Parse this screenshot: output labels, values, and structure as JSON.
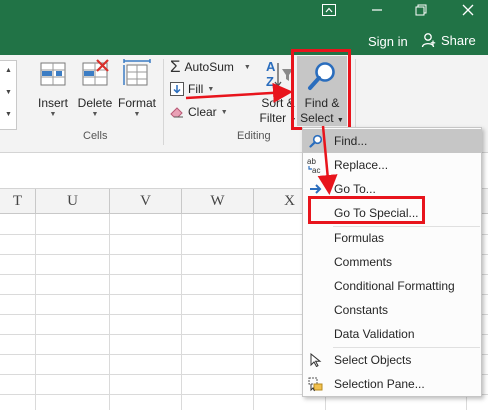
{
  "window": {
    "controls": [
      "restore-ribbon",
      "minimize",
      "restore",
      "close"
    ],
    "signin": "Sign in",
    "share": "Share"
  },
  "ribbon": {
    "cells_group": {
      "label": "Cells",
      "insert": "Insert",
      "delete": "Delete",
      "format": "Format"
    },
    "editing_group": {
      "label": "Editing",
      "autosum": "AutoSum",
      "fill": "Fill",
      "clear": "Clear",
      "sort_filter_line1": "Sort &",
      "sort_filter_line2": "Filter",
      "find_select_line1": "Find &",
      "find_select_line2": "Select"
    }
  },
  "grid": {
    "columns": [
      "T",
      "U",
      "V",
      "W",
      "X"
    ]
  },
  "menu": {
    "items": [
      {
        "label": "Find...",
        "icon": "magnifier-icon"
      },
      {
        "label": "Replace...",
        "icon": "replace-icon"
      },
      {
        "label": "Go To...",
        "icon": "arrow-right-icon"
      },
      {
        "label": "Go To Special...",
        "icon": ""
      },
      {
        "label": "Formulas",
        "icon": ""
      },
      {
        "label": "Comments",
        "icon": ""
      },
      {
        "label": "Conditional Formatting",
        "icon": ""
      },
      {
        "label": "Constants",
        "icon": ""
      },
      {
        "label": "Data Validation",
        "icon": ""
      },
      {
        "label": "Select Objects",
        "icon": "pointer-icon"
      },
      {
        "label": "Selection Pane...",
        "icon": "selection-pane-icon"
      }
    ]
  },
  "colors": {
    "title_green": "#217346",
    "annotation_red": "#e8141c",
    "menu_hover": "#c6c6c6"
  }
}
